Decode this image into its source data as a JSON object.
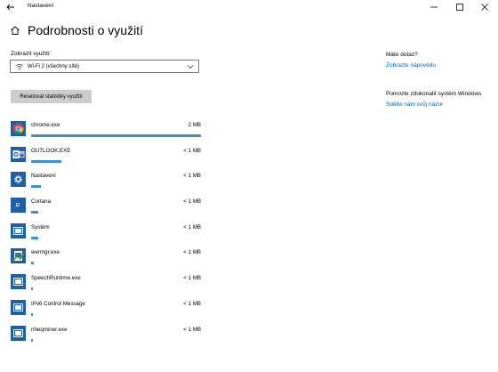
{
  "window": {
    "title": "Nastavení"
  },
  "page": {
    "title": "Podrobnosti o využití"
  },
  "usage_filter": {
    "label": "Zobrazit využití:",
    "selected": "Wi-Fi 2 (všechny sítě)"
  },
  "reset_button": {
    "label": "Resetovat statistiky využití"
  },
  "accent_color": "#3e8fd1",
  "apps": [
    {
      "name": "chrome.exe",
      "usage": "2 MB",
      "usage_fraction": 1.0,
      "icon": "chrome-icon"
    },
    {
      "name": "OUTLOOK.EXE",
      "usage": "< 1 MB",
      "usage_fraction": 0.18,
      "icon": "outlook-icon"
    },
    {
      "name": "Nastavení",
      "usage": "< 1 MB",
      "usage_fraction": 0.06,
      "icon": "gear-icon"
    },
    {
      "name": "Cortana",
      "usage": "< 1 MB",
      "usage_fraction": 0.04,
      "icon": "cortana-icon"
    },
    {
      "name": "Systém",
      "usage": "< 1 MB",
      "usage_fraction": 0.04,
      "icon": "system-window-icon"
    },
    {
      "name": "wermgr.exe",
      "usage": "< 1 MB",
      "usage_fraction": 0.015,
      "icon": "wermgr-icon"
    },
    {
      "name": "SpeechRuntime.exe",
      "usage": "< 1 MB",
      "usage_fraction": 0.01,
      "icon": "app-window-icon"
    },
    {
      "name": "IPv6 Control Message",
      "usage": "< 1 MB",
      "usage_fraction": 0.01,
      "icon": "app-window-icon"
    },
    {
      "name": "nheqminer.exe",
      "usage": "< 1 MB",
      "usage_fraction": 0.01,
      "icon": "app-window-icon"
    }
  ],
  "sidebar": {
    "question_heading": "Máte dotaz?",
    "help_link": "Zobrazte nápovědu",
    "improve_heading": "Pomozte zdokonalit systém Windows",
    "feedback_link": "Sdělte nám svůj názor"
  }
}
